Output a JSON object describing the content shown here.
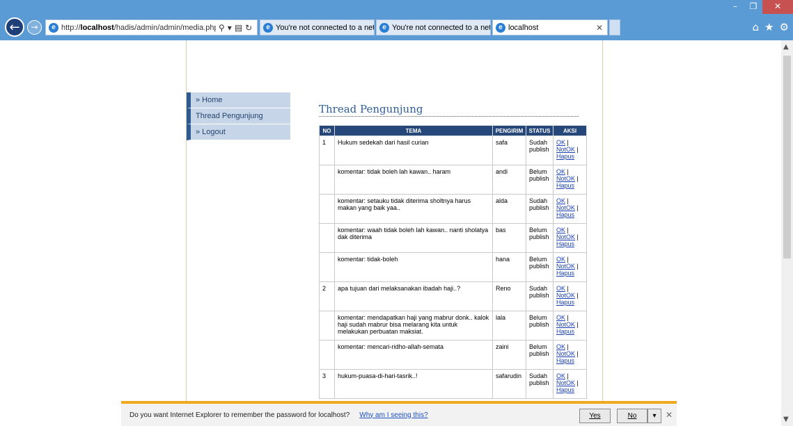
{
  "browser": {
    "address": {
      "prefix": "http://",
      "host": "localhost",
      "path": "/hadis/admin/admin/media.php?m"
    },
    "tabs": [
      {
        "label": "You're not connected to a net...",
        "active": false
      },
      {
        "label": "You're not connected to a net...",
        "active": false
      },
      {
        "label": "localhost",
        "active": true
      }
    ]
  },
  "menu": {
    "items": [
      {
        "label": "» Home"
      },
      {
        "label": "Thread Pengunjung"
      },
      {
        "label": "» Logout"
      }
    ]
  },
  "main": {
    "heading": "Thread Pengunjung",
    "table": {
      "headers": [
        "NO",
        "TEMA",
        "PENGIRIM",
        "STATUS",
        "AKSI"
      ],
      "rows": [
        {
          "no": "1",
          "tema": "Hukum sedekah dari hasil curian",
          "pengirim": "safa",
          "status": "Sudah publish"
        },
        {
          "no": "",
          "tema": "komentar: tidak boleh lah kawan.. haram",
          "pengirim": "andi",
          "status": "Belum publish"
        },
        {
          "no": "",
          "tema": "komentar: setauku tidak diterima sholtnya harus makan yang baik yaa..",
          "pengirim": "alda",
          "status": "Sudah publish"
        },
        {
          "no": "",
          "tema": "komentar: waah tidak boleh lah kawan.. nanti sholatya dak diterima",
          "pengirim": "bas",
          "status": "Belum publish"
        },
        {
          "no": "",
          "tema": "komentar: tidak-boleh",
          "pengirim": "hana",
          "status": "Belum publish"
        },
        {
          "no": "2",
          "tema": "apa tujuan dari melaksanakan ibadah haji..?",
          "pengirim": "Reno",
          "status": "Sudah publish"
        },
        {
          "no": "",
          "tema": "komentar: mendapatkan haji yang mabrur donk.. kalok haji sudah mabrur bisa melarang kita untuk melakukan perbuatan maksiat.",
          "pengirim": "lala",
          "status": "Belum publish"
        },
        {
          "no": "",
          "tema": "komentar: mencari-ridho-allah-semata",
          "pengirim": "zaini",
          "status": "Belum publish"
        },
        {
          "no": "3",
          "tema": "hukum-puasa-di-hari-tasrik..!",
          "pengirim": "safarudin",
          "status": "Sudah publish"
        }
      ],
      "actions": {
        "ok": "OK",
        "sep": "|",
        "notok": "NotOK",
        "hapus": "Hapus"
      }
    }
  },
  "notification": {
    "message": "Do you want Internet Explorer to remember the password for localhost?",
    "link": "Why am I seeing this?",
    "yes": "Yes",
    "no": "No"
  },
  "colors": {
    "chrome": "#5b9bd5",
    "table_header": "#25477a",
    "notif_border": "#f0a81c"
  }
}
